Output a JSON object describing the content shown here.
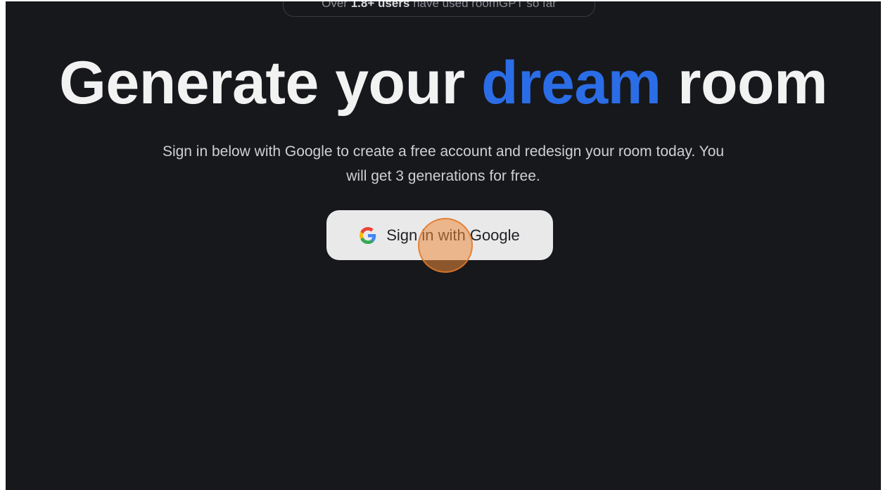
{
  "top_banner": {
    "prefix": "Over",
    "count": "1.8+ users",
    "suffix": "have used roomGPT so far"
  },
  "hero": {
    "headline_part1": "Generate your",
    "headline_accent": "dream",
    "headline_part2": "room",
    "subtitle": "Sign in below with Google to create a free account and redesign your room today. You will get 3 generations for free."
  },
  "sign_in": {
    "label": "Sign in with Google",
    "icon": "google-g-icon"
  },
  "colors": {
    "background": "#17181c",
    "accent": "#2b6de6",
    "button_bg": "#e9e9ea",
    "click_indicator": "#ec8c3c"
  }
}
